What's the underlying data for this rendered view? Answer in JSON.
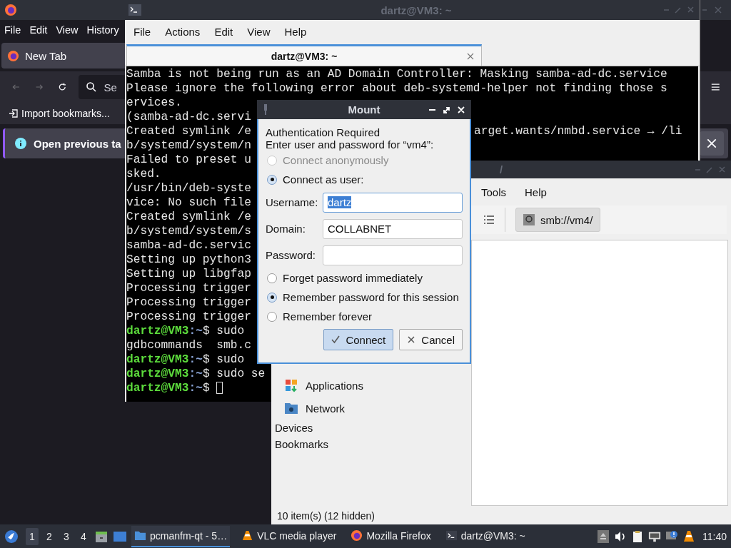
{
  "browser": {
    "menu": [
      "File",
      "Edit",
      "View",
      "History"
    ],
    "tab": {
      "label": "New Tab"
    },
    "search": {
      "placeholder": "Se"
    },
    "bookmark": "Import bookmarks...",
    "notification": "Open previous ta"
  },
  "terminal": {
    "title": "dartz@VM3: ~",
    "menu": [
      "File",
      "Actions",
      "Edit",
      "View",
      "Help"
    ],
    "tab": "dartz@VM3: ~",
    "lines": [
      {
        "kind": "text",
        "text": "Samba is not being run as an AD Domain Controller: Masking samba-ad-dc.service"
      },
      {
        "kind": "text",
        "text": "Please ignore the following error about deb-systemd-helper not finding those s"
      },
      {
        "kind": "text",
        "text": "ervices."
      },
      {
        "kind": "text",
        "text": "(samba-ad-dc.servi"
      },
      {
        "kind": "text",
        "text": "Created symlink /e",
        "right": "arget.wants/nmbd.service → /li"
      },
      {
        "kind": "text",
        "text": "b/systemd/system/n"
      },
      {
        "kind": "text",
        "text": "Failed to preset u"
      },
      {
        "kind": "text",
        "text": "sked."
      },
      {
        "kind": "text",
        "text": "/usr/bin/deb-syste"
      },
      {
        "kind": "text",
        "text": "vice: No such file"
      },
      {
        "kind": "text",
        "text": "Created symlink /e"
      },
      {
        "kind": "text",
        "text": "b/systemd/system/s"
      },
      {
        "kind": "text",
        "text": "samba-ad-dc.servic"
      },
      {
        "kind": "text",
        "text": "Setting up python3"
      },
      {
        "kind": "text",
        "text": "Setting up libgfap"
      },
      {
        "kind": "text",
        "text": "Processing trigger"
      },
      {
        "kind": "text",
        "text": "Processing trigger"
      },
      {
        "kind": "text",
        "text": "Processing trigger"
      },
      {
        "kind": "prompt",
        "user": "dartz@VM3",
        "path": ":~",
        "sign": "$",
        "command": "sudo"
      },
      {
        "kind": "text",
        "text": "gdbcommands  smb.c"
      },
      {
        "kind": "prompt",
        "user": "dartz@VM3",
        "path": ":~",
        "sign": "$",
        "command": "sudo"
      },
      {
        "kind": "prompt",
        "user": "dartz@VM3",
        "path": ":~",
        "sign": "$",
        "command": "sudo se"
      },
      {
        "kind": "prompt",
        "user": "dartz@VM3",
        "path": ":~",
        "sign": "$",
        "cursor": true
      }
    ]
  },
  "dialog": {
    "title": "Mount",
    "heading": "Authentication Required",
    "prompt": "Enter user and password for “vm4”:",
    "connect_options": [
      {
        "label": "Connect anonymously",
        "selected": false,
        "disabled": true
      },
      {
        "label": "Connect as user:",
        "selected": true,
        "disabled": false
      }
    ],
    "fields": [
      {
        "label": "Username:",
        "value": "dartz",
        "focused": true
      },
      {
        "label": "Domain:",
        "value": "COLLABNET",
        "focused": false
      },
      {
        "label": "Password:",
        "focused": false
      }
    ],
    "password_options": [
      {
        "label": "Forget password immediately",
        "selected": false
      },
      {
        "label": "Remember password for this session",
        "selected": true
      },
      {
        "label": "Remember forever",
        "selected": false
      }
    ],
    "buttons": [
      {
        "label": "Connect",
        "kind": "default"
      },
      {
        "label": "Cancel",
        "kind": "cancel"
      }
    ]
  },
  "file_manager": {
    "title": "/",
    "menu": [
      "Tools",
      "Help"
    ],
    "location": "smb://vm4/",
    "places": [
      {
        "label": "Applications",
        "kind": "applications"
      },
      {
        "label": "Network",
        "kind": "network"
      }
    ],
    "sections": [
      "Devices",
      "Bookmarks"
    ],
    "status": "10 item(s) (12 hidden)"
  },
  "taskbar": {
    "workspaces": [
      {
        "label": "1",
        "selected": true
      },
      {
        "label": "2",
        "selected": false
      },
      {
        "label": "3",
        "selected": false
      },
      {
        "label": "4",
        "selected": false
      }
    ],
    "tasks": [
      {
        "label": "pcmanfm-qt - 5…",
        "kind": "folder",
        "selected": true
      },
      {
        "label": "VLC media player",
        "kind": "vlc",
        "selected": false
      },
      {
        "label": "Mozilla Firefox",
        "kind": "firefox",
        "selected": false
      },
      {
        "label": "dartz@VM3: ~",
        "kind": "terminal",
        "selected": false
      }
    ],
    "clock": "11:40"
  }
}
